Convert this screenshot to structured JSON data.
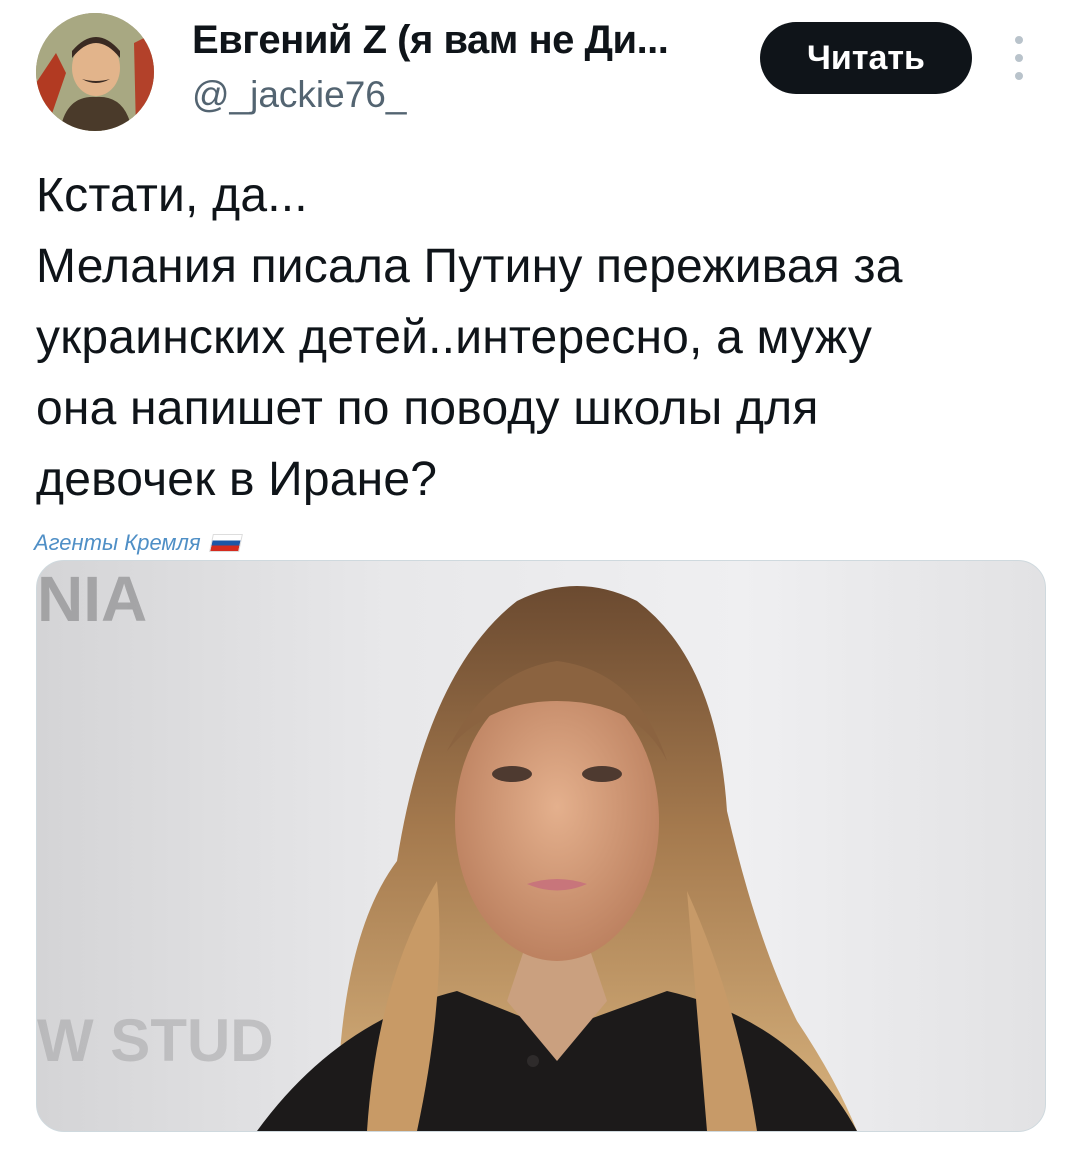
{
  "author": {
    "display_name": "Евгений Z (я вам не Ди...",
    "handle": "@_jackie76_",
    "avatar_icon": "avatar-portrait-icon"
  },
  "actions": {
    "follow_label": "Читать",
    "more_icon": "more-vertical-icon"
  },
  "tweet": {
    "lines": [
      "Кстати, да...",
      "Мелания писала Путину переживая за",
      "украинских детей..интересно, а мужу",
      "она напишет по поводу школы для",
      "девочек в Иране?"
    ]
  },
  "watermark": {
    "text": "Агенты Кремля",
    "icon": "russian-flag-icon"
  },
  "media": {
    "background_text_top": "NIA",
    "background_text_bottom": "W STUD"
  },
  "colors": {
    "text_primary": "#0f1419",
    "text_secondary": "#536471",
    "button_bg": "#0f1419",
    "button_text": "#ffffff",
    "watermark": "#4f8fc6"
  }
}
